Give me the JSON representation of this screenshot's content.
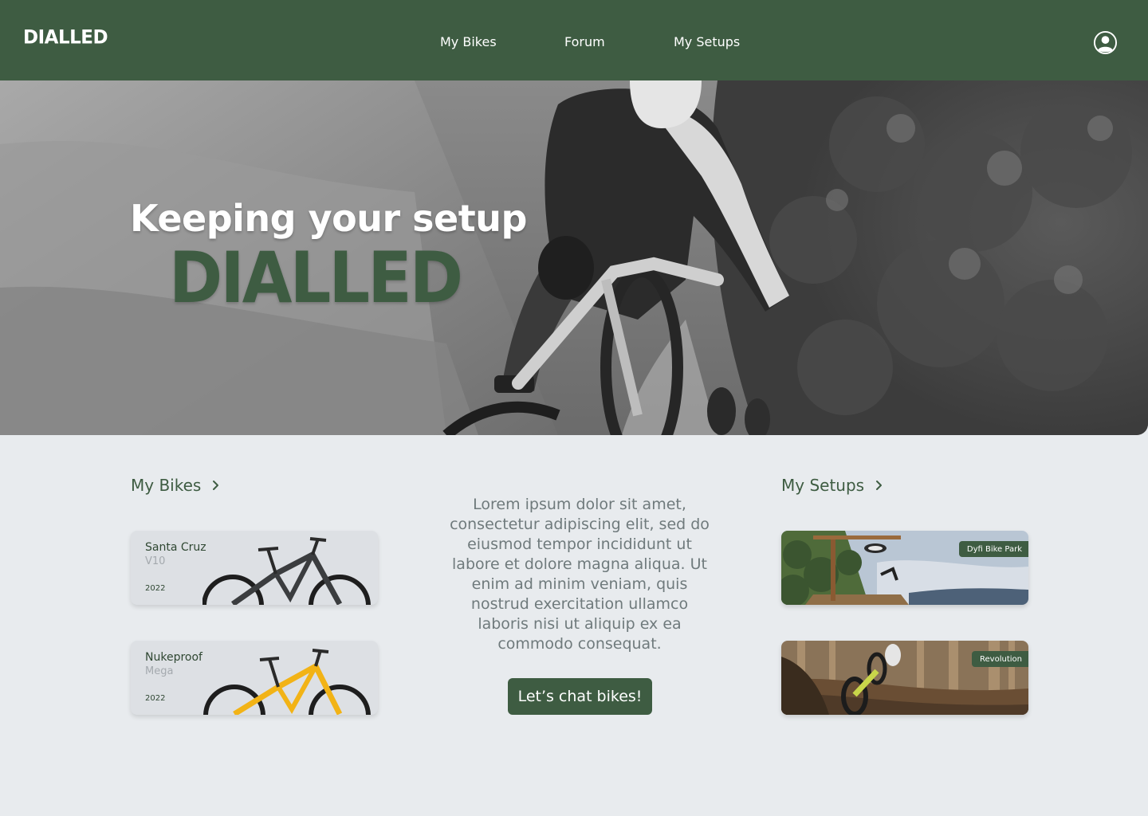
{
  "header": {
    "logo": "DIALLED",
    "nav": [
      {
        "label": "My Bikes"
      },
      {
        "label": "Forum"
      },
      {
        "label": "My Setups"
      }
    ],
    "user_icon": "user-circle-icon"
  },
  "hero": {
    "line1": "Keeping your setup",
    "line2": "DIALLED",
    "image": "mountain-biker-photo"
  },
  "my_bikes": {
    "heading": "My Bikes",
    "items": [
      {
        "brand": "Santa Cruz",
        "model": "V10",
        "year": "2022",
        "frame_color": "#3b3d3f"
      },
      {
        "brand": "Nukeproof",
        "model": "Mega",
        "year": "2022",
        "frame_color": "#f2b316"
      }
    ]
  },
  "center": {
    "text": "Lorem ipsum dolor sit amet, consectetur adipiscing elit, sed do eiusmod tempor incididunt ut labore et dolore magna aliqua. Ut enim ad minim veniam, quis nostrud exercitation ullamco laboris nisi ut aliquip ex ea commodo consequat.",
    "cta": "Let’s chat bikes!"
  },
  "my_setups": {
    "heading": "My Setups",
    "items": [
      {
        "tag": "Dyfi Bike Park"
      },
      {
        "tag": "Revolution"
      }
    ]
  },
  "colors": {
    "brand": "#3e5c42",
    "background": "#e8ebee"
  }
}
